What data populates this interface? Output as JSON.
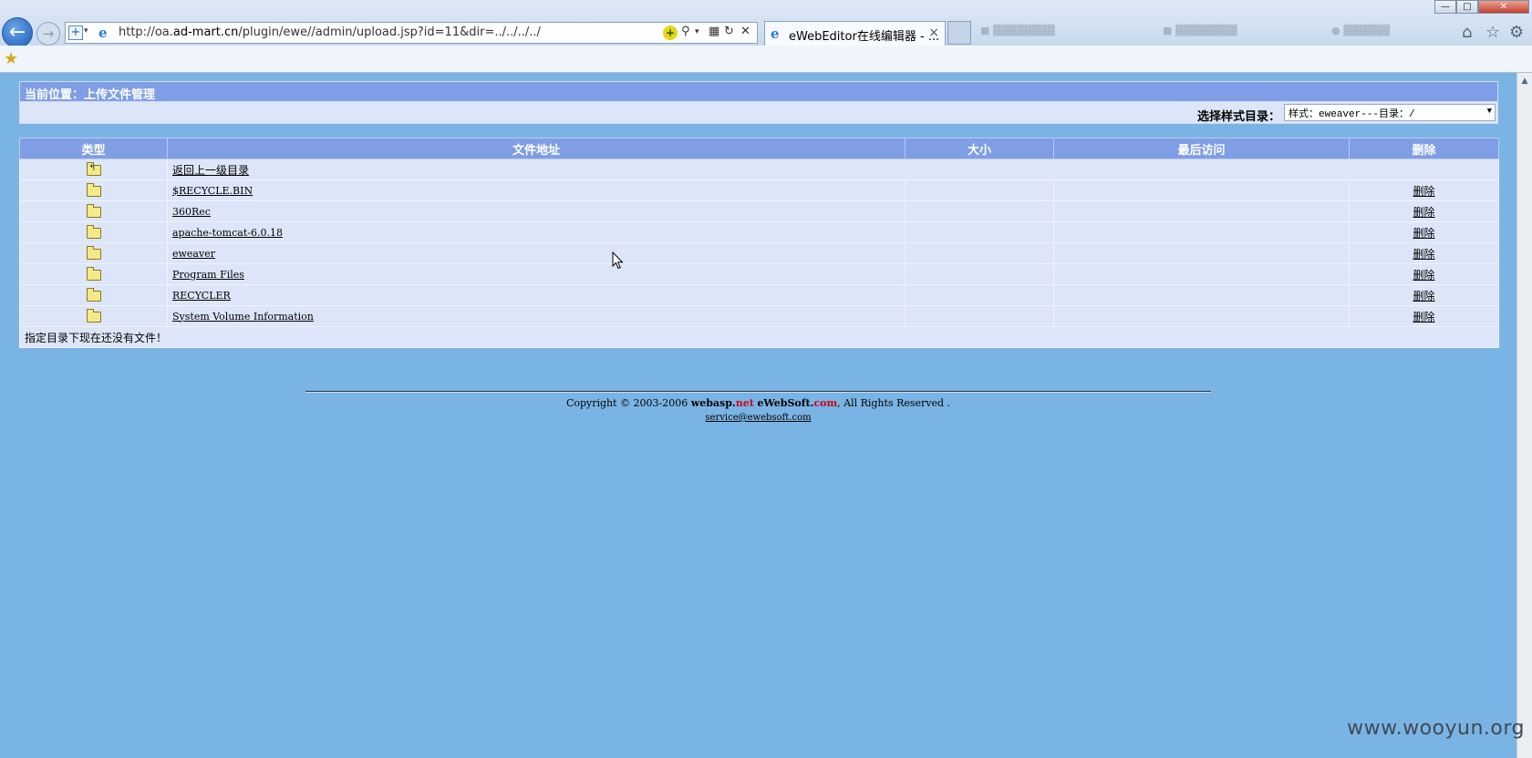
{
  "browser": {
    "address_url_prefix": "http://oa.",
    "address_url_domain": "ad-mart.cn",
    "address_url_suffix": "/plugin/ewe//admin/upload.jsp?id=11&dir=../../../../",
    "active_tab_title": "eWebEditor在线编辑器 - ...",
    "tab_close_glyph": "×"
  },
  "page": {
    "location_label": "当前位置：上传文件管理",
    "style_dir_label": "选择样式目录：",
    "style_select_value": "样式：eweaver---目录：/",
    "table": {
      "headers": [
        "类型",
        "文件地址",
        "大小",
        "最后访问",
        "删除"
      ],
      "parent_dir_link": "返回上一级目录",
      "rows": [
        {
          "name": "$RECYCLE.BIN",
          "size": "",
          "last_access": "",
          "delete": "删除"
        },
        {
          "name": "360Rec",
          "size": "",
          "last_access": "",
          "delete": "删除"
        },
        {
          "name": "apache-tomcat-6.0.18",
          "size": "",
          "last_access": "",
          "delete": "删除"
        },
        {
          "name": "eweaver",
          "size": "",
          "last_access": "",
          "delete": "删除"
        },
        {
          "name": "Program Files",
          "size": "",
          "last_access": "",
          "delete": "删除"
        },
        {
          "name": "RECYCLER",
          "size": "",
          "last_access": "",
          "delete": "删除"
        },
        {
          "name": "System Volume Information",
          "size": "",
          "last_access": "",
          "delete": "删除"
        }
      ],
      "empty_message": "指定目录下现在还没有文件！"
    },
    "footer": {
      "copyright_prefix": "Copyright © 2003-2006 ",
      "brand_a": "webasp",
      "brand_a_dot": ".",
      "brand_a_tld": "net",
      "brand_b": "eWebSoft",
      "brand_b_dot": ".",
      "brand_b_tld": "com",
      "copyright_suffix": ", All Rights Reserved .",
      "email": "service@ewebsoft.com"
    }
  },
  "watermark": "www.wooyun.org",
  "colors": {
    "page_bg": "#7ab4e4",
    "header_bg": "#7f9ee5",
    "row_bg": "#dde6f8",
    "brand_red": "#d0021b"
  },
  "icons": {
    "folder": "folder-icon",
    "parent_folder": "folder-up-icon",
    "back": "back-arrow-icon",
    "favorites": "favorites-star-icon"
  }
}
